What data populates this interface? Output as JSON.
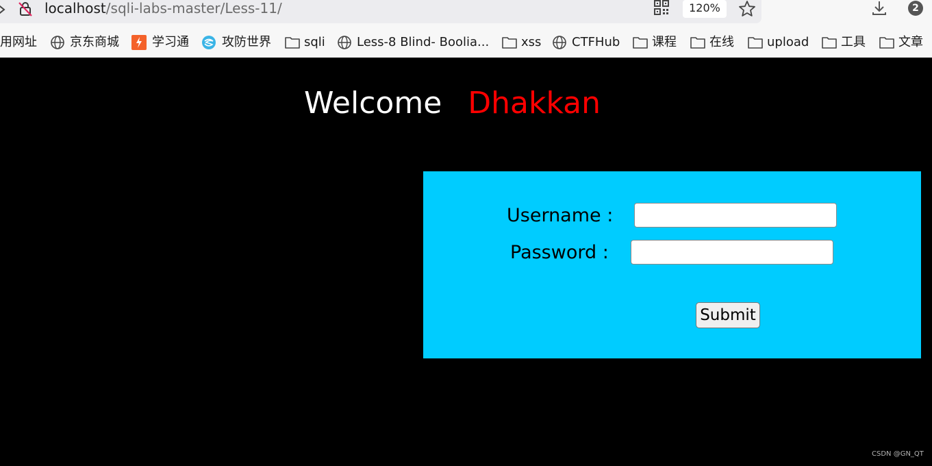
{
  "address_bar": {
    "host": "localhost",
    "path": "/sqli-labs-master/Less-11/",
    "zoom": "120%",
    "downloads_badge": "2"
  },
  "bookmarks": [
    {
      "label": "用网址",
      "icon": "none"
    },
    {
      "label": "京东商城",
      "icon": "globe-icon"
    },
    {
      "label": "学习通",
      "icon": "xuexitong-icon"
    },
    {
      "label": "攻防世界",
      "icon": "gongfang-icon"
    },
    {
      "label": "sqli",
      "icon": "folder-icon"
    },
    {
      "label": "Less-8 Blind- Boolia...",
      "icon": "globe-icon"
    },
    {
      "label": "xss",
      "icon": "folder-icon"
    },
    {
      "label": "CTFHub",
      "icon": "globe-icon"
    },
    {
      "label": "课程",
      "icon": "folder-icon"
    },
    {
      "label": "在线",
      "icon": "folder-icon"
    },
    {
      "label": "upload",
      "icon": "folder-icon"
    },
    {
      "label": "工具",
      "icon": "folder-icon"
    },
    {
      "label": "文章",
      "icon": "folder-icon"
    }
  ],
  "page": {
    "welcome": "Welcome",
    "name": "Dhakkan",
    "name_color": "#ff0000",
    "panel_color": "#00ccff",
    "form": {
      "username_label": "Username :",
      "username_value": "",
      "password_label": "Password :",
      "password_value": "",
      "submit_label": "Submit"
    }
  },
  "watermark": "CSDN @GN_QT"
}
